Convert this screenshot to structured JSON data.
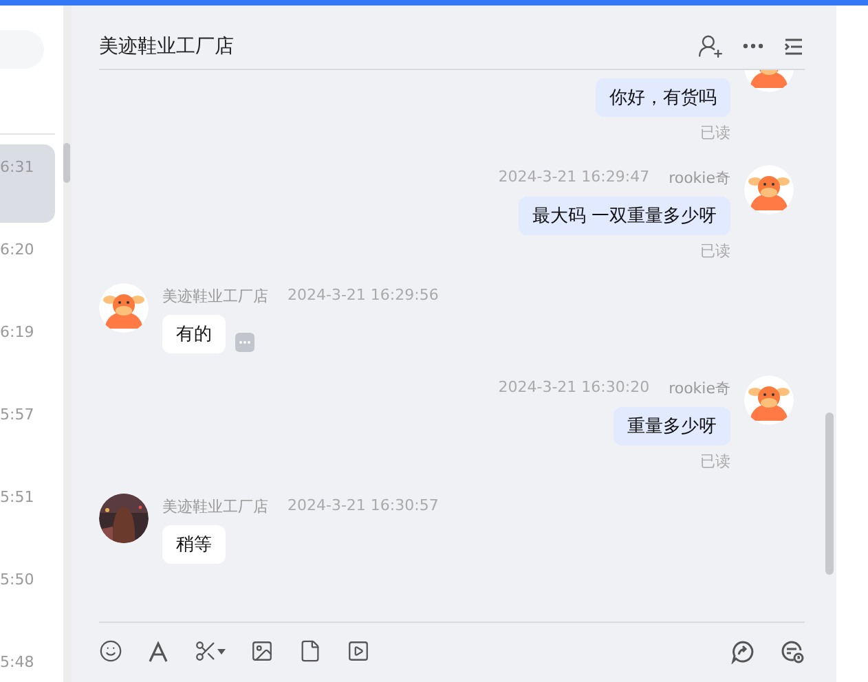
{
  "sidebar": {
    "items": [
      {
        "time": "6:31",
        "selected": true
      },
      {
        "time": "6:20",
        "selected": false
      },
      {
        "time": "6:19",
        "selected": false
      },
      {
        "time": "5:57",
        "selected": false
      },
      {
        "time": "5:51",
        "selected": false
      },
      {
        "time": "5:50",
        "selected": false
      },
      {
        "time": "5:48",
        "selected": false
      }
    ]
  },
  "chat": {
    "title": "美迹鞋业工厂店",
    "messages": [
      {
        "kind": "outgoing",
        "avatar": {
          "kind": "cow"
        },
        "text": "你好，有货吗",
        "status": "已读"
      },
      {
        "kind": "outgoing",
        "avatar": {
          "kind": "cow"
        },
        "time": "2024-3-21 16:29:47",
        "sender": "rookie奇",
        "text": "最大码 一双重量多少呀",
        "status": "已读"
      },
      {
        "kind": "incoming",
        "avatar": {
          "kind": "cow"
        },
        "sender": "美迹鞋业工厂店",
        "time": "2024-3-21 16:29:56",
        "text": "有的",
        "more_button": true
      },
      {
        "kind": "outgoing",
        "avatar": {
          "kind": "cow"
        },
        "time": "2024-3-21 16:30:20",
        "sender": "rookie奇",
        "text": "重量多少呀",
        "status": "已读"
      },
      {
        "kind": "incoming",
        "sender": "美迹鞋业工厂店",
        "time": "2024-3-21 16:30:57",
        "text": "稍等"
      }
    ]
  }
}
